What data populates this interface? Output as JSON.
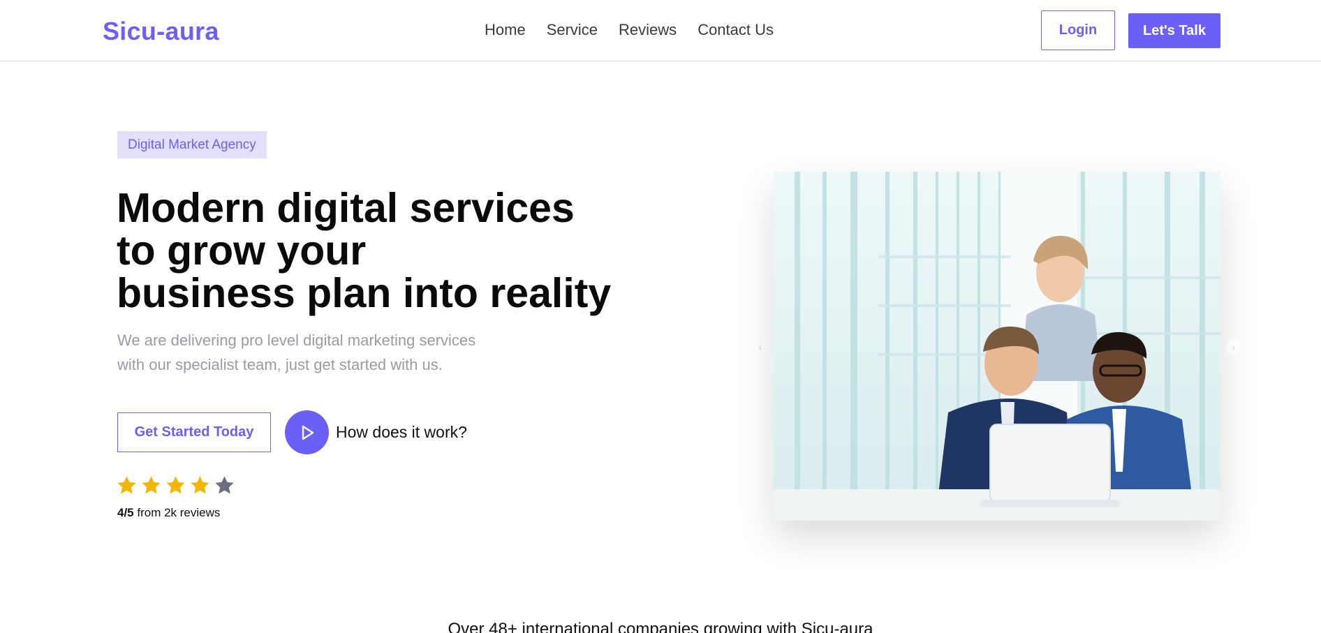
{
  "header": {
    "brand": "Sicu-aura",
    "nav": [
      "Home",
      "Service",
      "Reviews",
      "Contact Us"
    ],
    "login_label": "Login",
    "talk_label": "Let's Talk"
  },
  "hero": {
    "badge": "Digital Market Agency",
    "headline": [
      "Modern digital services",
      "to grow your",
      "business plan into reality"
    ],
    "subtext": [
      "We are delivering pro level digital marketing services",
      "with our specialist team, just get started with us."
    ],
    "cta_label": "Get Started Today",
    "how_label": "How does it work?",
    "rating": {
      "score": "4/5",
      "suffix": "from 2k reviews",
      "filled_stars": 4,
      "total_stars": 5
    },
    "image_icon": "business-team-photo"
  },
  "companies": {
    "text": "Over 48+ international companies growing with Sicu-aura"
  },
  "colors": {
    "accent": "#6c5ff5",
    "star_filled": "#f2b705",
    "star_empty": "#6b6f80",
    "badge_bg": "#e3e0fc"
  }
}
